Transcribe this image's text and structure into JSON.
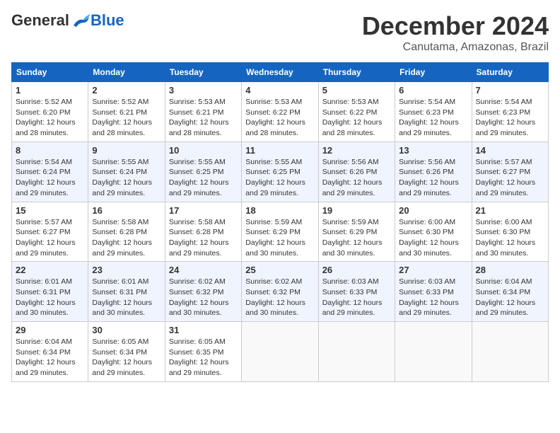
{
  "header": {
    "logo_general": "General",
    "logo_blue": "Blue",
    "month": "December 2024",
    "location": "Canutama, Amazonas, Brazil"
  },
  "days_of_week": [
    "Sunday",
    "Monday",
    "Tuesday",
    "Wednesday",
    "Thursday",
    "Friday",
    "Saturday"
  ],
  "weeks": [
    [
      {
        "day": "1",
        "detail": "Sunrise: 5:52 AM\nSunset: 6:20 PM\nDaylight: 12 hours\nand 28 minutes."
      },
      {
        "day": "2",
        "detail": "Sunrise: 5:52 AM\nSunset: 6:21 PM\nDaylight: 12 hours\nand 28 minutes."
      },
      {
        "day": "3",
        "detail": "Sunrise: 5:53 AM\nSunset: 6:21 PM\nDaylight: 12 hours\nand 28 minutes."
      },
      {
        "day": "4",
        "detail": "Sunrise: 5:53 AM\nSunset: 6:22 PM\nDaylight: 12 hours\nand 28 minutes."
      },
      {
        "day": "5",
        "detail": "Sunrise: 5:53 AM\nSunset: 6:22 PM\nDaylight: 12 hours\nand 28 minutes."
      },
      {
        "day": "6",
        "detail": "Sunrise: 5:54 AM\nSunset: 6:23 PM\nDaylight: 12 hours\nand 29 minutes."
      },
      {
        "day": "7",
        "detail": "Sunrise: 5:54 AM\nSunset: 6:23 PM\nDaylight: 12 hours\nand 29 minutes."
      }
    ],
    [
      {
        "day": "8",
        "detail": "Sunrise: 5:54 AM\nSunset: 6:24 PM\nDaylight: 12 hours\nand 29 minutes."
      },
      {
        "day": "9",
        "detail": "Sunrise: 5:55 AM\nSunset: 6:24 PM\nDaylight: 12 hours\nand 29 minutes."
      },
      {
        "day": "10",
        "detail": "Sunrise: 5:55 AM\nSunset: 6:25 PM\nDaylight: 12 hours\nand 29 minutes."
      },
      {
        "day": "11",
        "detail": "Sunrise: 5:55 AM\nSunset: 6:25 PM\nDaylight: 12 hours\nand 29 minutes."
      },
      {
        "day": "12",
        "detail": "Sunrise: 5:56 AM\nSunset: 6:26 PM\nDaylight: 12 hours\nand 29 minutes."
      },
      {
        "day": "13",
        "detail": "Sunrise: 5:56 AM\nSunset: 6:26 PM\nDaylight: 12 hours\nand 29 minutes."
      },
      {
        "day": "14",
        "detail": "Sunrise: 5:57 AM\nSunset: 6:27 PM\nDaylight: 12 hours\nand 29 minutes."
      }
    ],
    [
      {
        "day": "15",
        "detail": "Sunrise: 5:57 AM\nSunset: 6:27 PM\nDaylight: 12 hours\nand 29 minutes."
      },
      {
        "day": "16",
        "detail": "Sunrise: 5:58 AM\nSunset: 6:28 PM\nDaylight: 12 hours\nand 29 minutes."
      },
      {
        "day": "17",
        "detail": "Sunrise: 5:58 AM\nSunset: 6:28 PM\nDaylight: 12 hours\nand 29 minutes."
      },
      {
        "day": "18",
        "detail": "Sunrise: 5:59 AM\nSunset: 6:29 PM\nDaylight: 12 hours\nand 30 minutes."
      },
      {
        "day": "19",
        "detail": "Sunrise: 5:59 AM\nSunset: 6:29 PM\nDaylight: 12 hours\nand 30 minutes."
      },
      {
        "day": "20",
        "detail": "Sunrise: 6:00 AM\nSunset: 6:30 PM\nDaylight: 12 hours\nand 30 minutes."
      },
      {
        "day": "21",
        "detail": "Sunrise: 6:00 AM\nSunset: 6:30 PM\nDaylight: 12 hours\nand 30 minutes."
      }
    ],
    [
      {
        "day": "22",
        "detail": "Sunrise: 6:01 AM\nSunset: 6:31 PM\nDaylight: 12 hours\nand 30 minutes."
      },
      {
        "day": "23",
        "detail": "Sunrise: 6:01 AM\nSunset: 6:31 PM\nDaylight: 12 hours\nand 30 minutes."
      },
      {
        "day": "24",
        "detail": "Sunrise: 6:02 AM\nSunset: 6:32 PM\nDaylight: 12 hours\nand 30 minutes."
      },
      {
        "day": "25",
        "detail": "Sunrise: 6:02 AM\nSunset: 6:32 PM\nDaylight: 12 hours\nand 30 minutes."
      },
      {
        "day": "26",
        "detail": "Sunrise: 6:03 AM\nSunset: 6:33 PM\nDaylight: 12 hours\nand 29 minutes."
      },
      {
        "day": "27",
        "detail": "Sunrise: 6:03 AM\nSunset: 6:33 PM\nDaylight: 12 hours\nand 29 minutes."
      },
      {
        "day": "28",
        "detail": "Sunrise: 6:04 AM\nSunset: 6:34 PM\nDaylight: 12 hours\nand 29 minutes."
      }
    ],
    [
      {
        "day": "29",
        "detail": "Sunrise: 6:04 AM\nSunset: 6:34 PM\nDaylight: 12 hours\nand 29 minutes."
      },
      {
        "day": "30",
        "detail": "Sunrise: 6:05 AM\nSunset: 6:34 PM\nDaylight: 12 hours\nand 29 minutes."
      },
      {
        "day": "31",
        "detail": "Sunrise: 6:05 AM\nSunset: 6:35 PM\nDaylight: 12 hours\nand 29 minutes."
      },
      {
        "day": "",
        "detail": ""
      },
      {
        "day": "",
        "detail": ""
      },
      {
        "day": "",
        "detail": ""
      },
      {
        "day": "",
        "detail": ""
      }
    ]
  ]
}
